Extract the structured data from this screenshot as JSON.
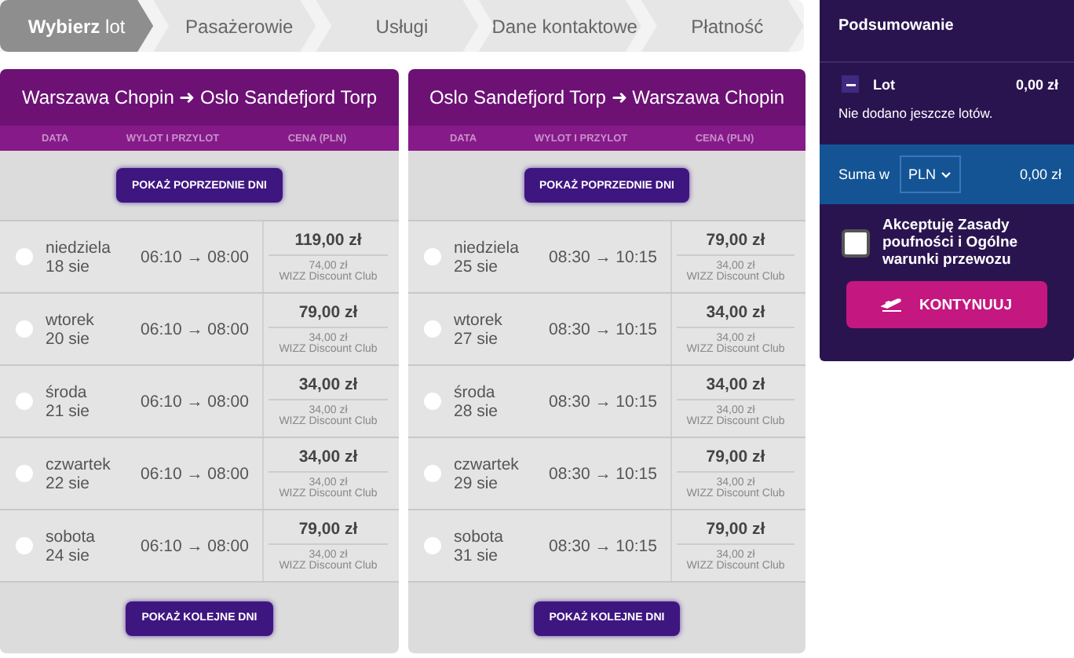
{
  "steps": [
    {
      "label": "**Wybierz** lot",
      "selected": true
    },
    {
      "label": "Pasażerowie",
      "selected": false
    },
    {
      "label": "Usługi",
      "selected": false
    },
    {
      "label": "Dane kontaktowe",
      "selected": false
    },
    {
      "label": "Płatność",
      "selected": false
    }
  ],
  "panels": [
    {
      "title": "Warszawa Chopin ➜ Oslo Sandefjord Torp",
      "columns": [
        "DATA",
        "WYLOT I PRZYLOT",
        "CENA (PLN)"
      ],
      "prev_button": "POKAŻ POPRZEDNIE DNI",
      "next_button": "POKAŻ KOLEJNE DNI",
      "flights": [
        {
          "day": "niedziela",
          "date": "18 sie",
          "times": "06:10 → 08:00",
          "price": "119,00 zł",
          "club_price": "74,00 zł",
          "club": "WIZZ Discount Club",
          "selected": false
        },
        {
          "day": "wtorek",
          "date": "20 sie",
          "times": "06:10 → 08:00",
          "price": "79,00 zł",
          "club_price": "34,00 zł",
          "club": "WIZZ Discount Club",
          "selected": false
        },
        {
          "day": "środa",
          "date": "21 sie",
          "times": "06:10 → 08:00",
          "price": "34,00 zł",
          "club_price": "34,00 zł",
          "club": "WIZZ Discount Club",
          "selected": false
        },
        {
          "day": "czwartek",
          "date": "22 sie",
          "times": "06:10 → 08:00",
          "price": "34,00 zł",
          "club_price": "34,00 zł",
          "club": "WIZZ Discount Club",
          "selected": false
        },
        {
          "day": "sobota",
          "date": "24 sie",
          "times": "06:10 → 08:00",
          "price": "79,00 zł",
          "club_price": "34,00 zł",
          "club": "WIZZ Discount Club",
          "selected": false
        }
      ]
    },
    {
      "title": "Oslo Sandefjord Torp ➜ Warszawa Chopin",
      "columns": [
        "DATA",
        "WYLOT I PRZYLOT",
        "CENA (PLN)"
      ],
      "prev_button": "POKAŻ POPRZEDNIE DNI",
      "next_button": "POKAŻ KOLEJNE DNI",
      "flights": [
        {
          "day": "niedziela",
          "date": "25 sie",
          "times": "08:30 → 10:15",
          "price": "79,00 zł",
          "club_price": "34,00 zł",
          "club": "WIZZ Discount Club",
          "selected": false
        },
        {
          "day": "wtorek",
          "date": "27 sie",
          "times": "08:30 → 10:15",
          "price": "34,00 zł",
          "club_price": "34,00 zł",
          "club": "WIZZ Discount Club",
          "selected": false
        },
        {
          "day": "środa",
          "date": "28 sie",
          "times": "08:30 → 10:15",
          "price": "34,00 zł",
          "club_price": "34,00 zł",
          "club": "WIZZ Discount Club",
          "selected": false
        },
        {
          "day": "czwartek",
          "date": "29 sie",
          "times": "08:30 → 10:15",
          "price": "79,00 zł",
          "club_price": "34,00 zł",
          "club": "WIZZ Discount Club",
          "selected": false
        },
        {
          "day": "sobota",
          "date": "31 sie",
          "times": "08:30 → 10:15",
          "price": "79,00 zł",
          "club_price": "34,00 zł",
          "club": "WIZZ Discount Club",
          "selected": false
        }
      ]
    }
  ],
  "summary": {
    "title": "Podsumowanie",
    "section": {
      "label": "Lot",
      "amount": "0,00 zł",
      "expanded": true,
      "note": "Nie dodano jeszcze lotów."
    },
    "total_label": "Suma w",
    "currency": "PLN",
    "total": "0,00 zł",
    "terms": {
      "label": "Akceptuję Zasady poufności i Ogólne warunki przewozu",
      "checked": false
    },
    "continue_button": "KONTYNUUJ"
  }
}
